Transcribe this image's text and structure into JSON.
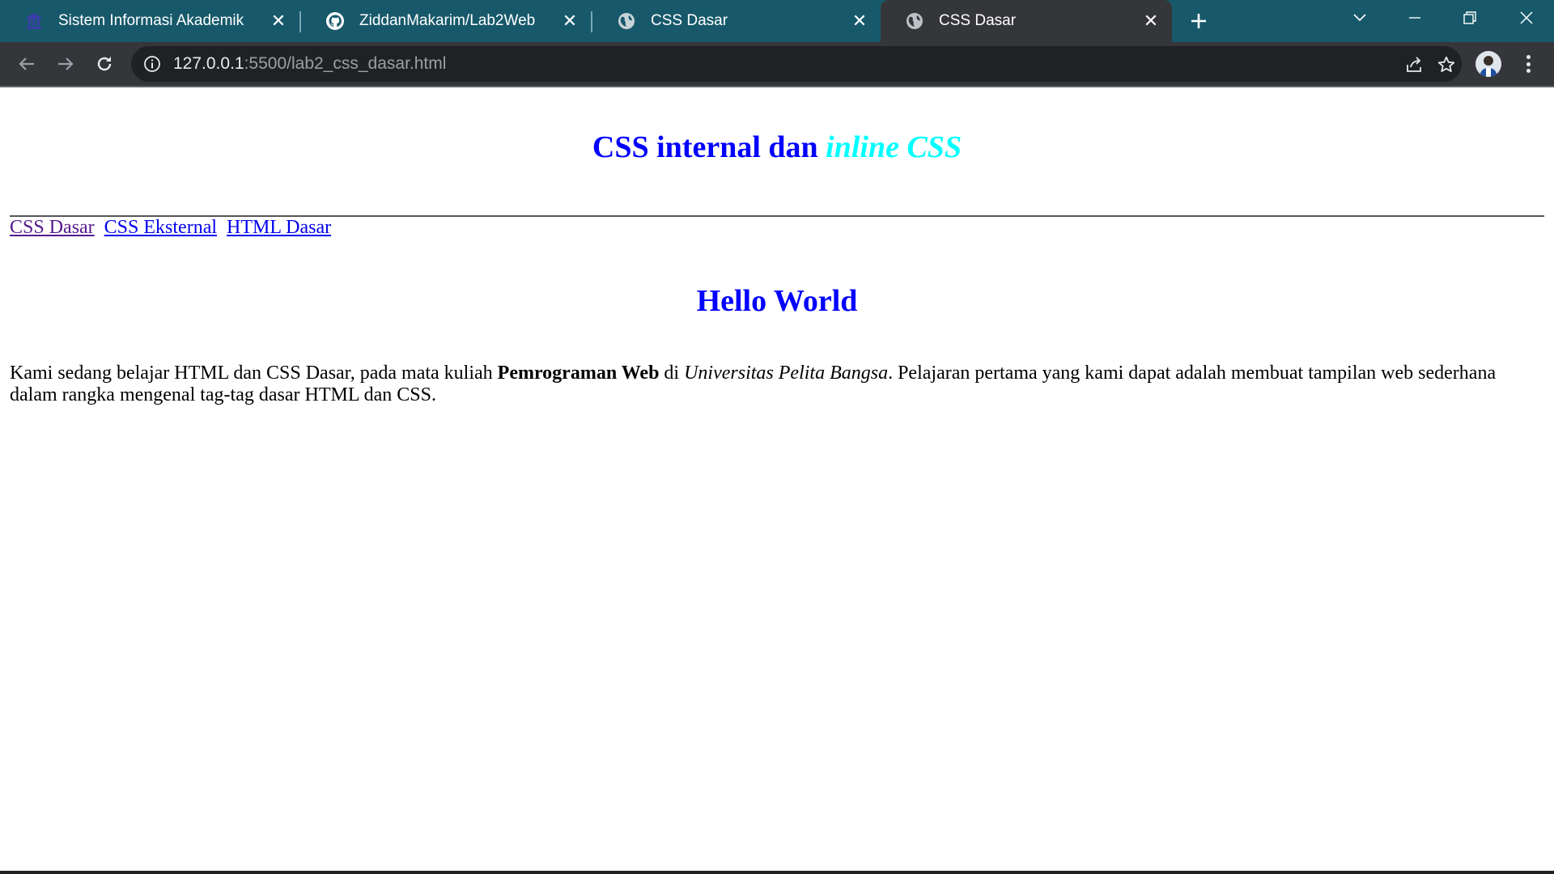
{
  "browser": {
    "tabs": [
      {
        "title": "Sistem Informasi Akademik",
        "icon": "university-logo-icon",
        "active": false
      },
      {
        "title": "ZiddanMakarim/Lab2Web",
        "icon": "github-icon",
        "active": false
      },
      {
        "title": "CSS Dasar",
        "icon": "globe-icon",
        "active": false
      },
      {
        "title": "CSS Dasar",
        "icon": "globe-icon",
        "active": true
      }
    ],
    "address": {
      "host": "127.0.0.1",
      "rest": ":5500/lab2_css_dasar.html"
    },
    "colors": {
      "tabstrip": "#17596b",
      "toolbar": "#35363a",
      "omnibox": "#202124"
    }
  },
  "page": {
    "heading_part1": "CSS internal dan ",
    "heading_part2": "inline CSS",
    "nav_links": [
      "CSS Dasar",
      "CSS Eksternal",
      "HTML Dasar"
    ],
    "subheading": "Hello World",
    "paragraph": {
      "t1": "Kami sedang belajar HTML dan CSS Dasar, pada mata kuliah ",
      "bold": "Pemrograman Web",
      "t2": " di ",
      "italic": "Universitas Pelita Bangsa",
      "t3": ". Pelajaran pertama yang kami dapat adalah membuat tampilan web sederhana dalam rangka mengenal tag-tag dasar HTML dan CSS."
    },
    "colors": {
      "heading": "#0000ff",
      "heading_inline": "#00ffff",
      "link": "#0000ee",
      "link_visited": "#551a8b"
    }
  }
}
